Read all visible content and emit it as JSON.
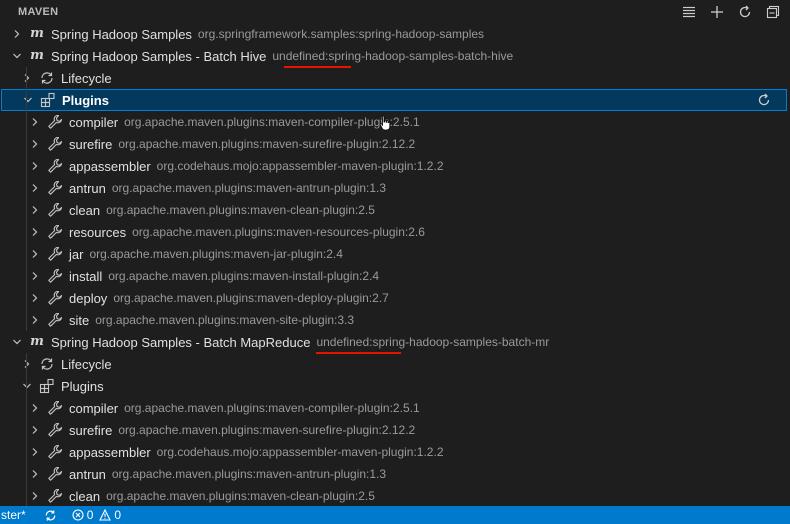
{
  "header": {
    "title": "MAVEN",
    "actions": [
      "list-icon",
      "plus-icon",
      "refresh-icon",
      "collapse-all-icon"
    ]
  },
  "tree": [
    {
      "label": "Spring Hadoop Samples",
      "desc": "org.springframework.samples:spring-hadoop-samples",
      "level": 0,
      "icon": "maven-icon",
      "expanded": false
    },
    {
      "label": "Spring Hadoop Samples - Batch Hive",
      "desc": "undefined:spring-hadoop-samples-batch-hive",
      "level": 0,
      "icon": "maven-icon",
      "expanded": true
    },
    {
      "label": "Lifecycle",
      "desc": "",
      "level": 1,
      "icon": "lifecycle-icon",
      "expanded": false
    },
    {
      "label": "Plugins",
      "desc": "",
      "level": 1,
      "icon": "extensions-icon",
      "expanded": true,
      "selected": true
    },
    {
      "label": "compiler",
      "desc": "org.apache.maven.plugins:maven-compiler-plugin:2.5.1",
      "level": 2,
      "icon": "wrench-icon",
      "expanded": false
    },
    {
      "label": "surefire",
      "desc": "org.apache.maven.plugins:maven-surefire-plugin:2.12.2",
      "level": 2,
      "icon": "wrench-icon",
      "expanded": false
    },
    {
      "label": "appassembler",
      "desc": "org.codehaus.mojo:appassembler-maven-plugin:1.2.2",
      "level": 2,
      "icon": "wrench-icon",
      "expanded": false
    },
    {
      "label": "antrun",
      "desc": "org.apache.maven.plugins:maven-antrun-plugin:1.3",
      "level": 2,
      "icon": "wrench-icon",
      "expanded": false
    },
    {
      "label": "clean",
      "desc": "org.apache.maven.plugins:maven-clean-plugin:2.5",
      "level": 2,
      "icon": "wrench-icon",
      "expanded": false
    },
    {
      "label": "resources",
      "desc": "org.apache.maven.plugins:maven-resources-plugin:2.6",
      "level": 2,
      "icon": "wrench-icon",
      "expanded": false
    },
    {
      "label": "jar",
      "desc": "org.apache.maven.plugins:maven-jar-plugin:2.4",
      "level": 2,
      "icon": "wrench-icon",
      "expanded": false
    },
    {
      "label": "install",
      "desc": "org.apache.maven.plugins:maven-install-plugin:2.4",
      "level": 2,
      "icon": "wrench-icon",
      "expanded": false
    },
    {
      "label": "deploy",
      "desc": "org.apache.maven.plugins:maven-deploy-plugin:2.7",
      "level": 2,
      "icon": "wrench-icon",
      "expanded": false
    },
    {
      "label": "site",
      "desc": "org.apache.maven.plugins:maven-site-plugin:3.3",
      "level": 2,
      "icon": "wrench-icon",
      "expanded": false
    },
    {
      "label": "Spring Hadoop Samples - Batch MapReduce",
      "desc": "undefined:spring-hadoop-samples-batch-mr",
      "level": 0,
      "icon": "maven-icon",
      "expanded": true
    },
    {
      "label": "Lifecycle",
      "desc": "",
      "level": 1,
      "icon": "lifecycle-icon",
      "expanded": false
    },
    {
      "label": "Plugins",
      "desc": "",
      "level": 1,
      "icon": "extensions-icon",
      "expanded": true
    },
    {
      "label": "compiler",
      "desc": "org.apache.maven.plugins:maven-compiler-plugin:2.5.1",
      "level": 2,
      "icon": "wrench-icon",
      "expanded": false
    },
    {
      "label": "surefire",
      "desc": "org.apache.maven.plugins:maven-surefire-plugin:2.12.2",
      "level": 2,
      "icon": "wrench-icon",
      "expanded": false
    },
    {
      "label": "appassembler",
      "desc": "org.codehaus.mojo:appassembler-maven-plugin:1.2.2",
      "level": 2,
      "icon": "wrench-icon",
      "expanded": false
    },
    {
      "label": "antrun",
      "desc": "org.apache.maven.plugins:maven-antrun-plugin:1.3",
      "level": 2,
      "icon": "wrench-icon",
      "expanded": false
    },
    {
      "label": "clean",
      "desc": "org.apache.maven.plugins:maven-clean-plugin:2.5",
      "level": 2,
      "icon": "wrench-icon",
      "expanded": false
    }
  ],
  "selected_row_action": "refresh-icon",
  "statusbar": {
    "branch": "ster*",
    "sync_icon": "sync-icon",
    "errors": "0",
    "warnings": "0",
    "background": "#007acc"
  },
  "colors": {
    "background": "#1e1e1e",
    "selection": "#04395e",
    "selection_border": "#007fd4",
    "annotation": "#e51400"
  }
}
